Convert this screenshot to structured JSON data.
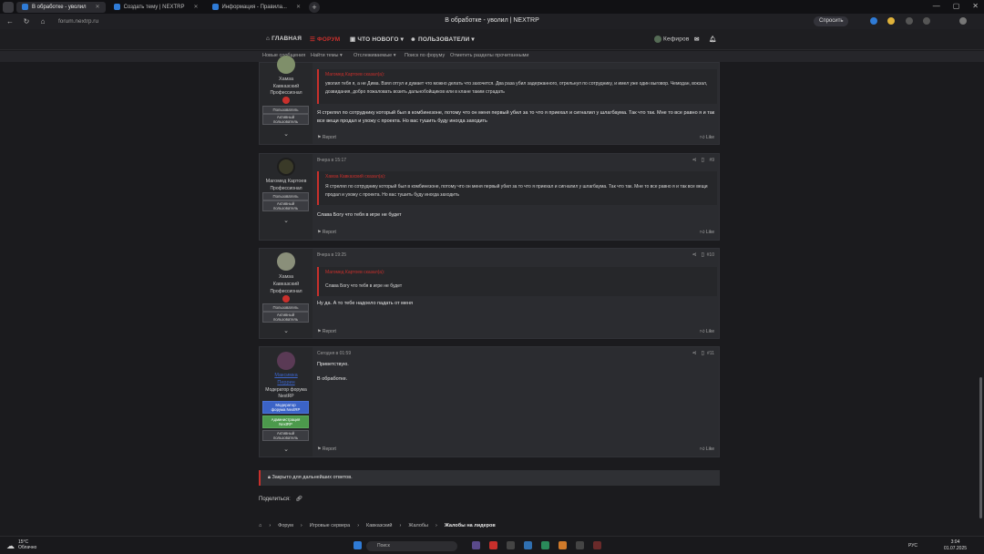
{
  "browser": {
    "tabs": [
      {
        "label": "В обработке - уволил"
      },
      {
        "label": "Создать тему | NEXTRP"
      },
      {
        "label": "Информация - Правила..."
      }
    ],
    "url": "forum.nextrp.ru",
    "page_title": "В обработке - уволил | NEXTRP",
    "ask_button": "Спросить"
  },
  "site": {
    "nav": [
      "ГЛАВНАЯ",
      "ФОРУМ",
      "ЧТО НОВОГО",
      "ПОЛЬЗОВАТЕЛИ"
    ],
    "user": "Кефиров",
    "subnav": [
      "Новые сообщения",
      "Найти темы",
      "Отслеживаемые",
      "Поиск по форуму",
      "Отметить разделы прочитанными"
    ]
  },
  "posts": [
    {
      "author": "Хамза Кавказский",
      "rank": "Профессионал",
      "badges": [
        "Пользователь",
        "Активный пользователь"
      ],
      "date": "",
      "number": "",
      "quote_author": "Магомед Картоев сказал(а):",
      "quote": "уволил тебя я, а не Дима. Взял отгул и думает что можно делать что захочется. Два раза убил задержанного, отрельнул по сотруднику, и имел уже один выговор. Чемодан, вокзал, дозвидания, добро пожаловать возить дальнобойщиков или в клане таким страдать",
      "text": "Я стрелял по сотруднику который был в комбинезоне, потому что он меня первый убил за то что я приехал и сигналил у шлагбаума. Так что так. Мне то все равно я и так все вещи продал и ухожу с проекта. Но вас тушить буду иногда заходить",
      "report": "Report",
      "like": "Like"
    },
    {
      "author": "Магомед Картоев",
      "rank": "Профессионал",
      "badges": [
        "Пользователь",
        "Активный пользователь"
      ],
      "date": "Вчера в 15:17",
      "number": "#9",
      "quote_author": "Хамза Кавказский сказал(а):",
      "quote": "Я стрелял по сотруднику который был в комбинезоне, потому что он меня первый убил за то что я приехал и сигналил у шлагбаума. Так что так. Мне то все равно я и так все вещи продал и ухожу с проекта. Но вас тушить буду иногда заходить",
      "text": "Слава Богу что тебя в игре не будет",
      "report": "Report",
      "like": "Like"
    },
    {
      "author": "Хамза Кавказский",
      "rank": "Профессионал",
      "badges": [
        "Пользователь",
        "Активный пользователь"
      ],
      "date": "Вчера в 19:25",
      "number": "#10",
      "quote_author": "Магомед Картоев сказал(а):",
      "quote": "Слава Богу что тебя в игре не будет",
      "text": "Ну да. А то тебе надоело падать от меня",
      "report": "Report",
      "like": "Like"
    },
    {
      "author": "Максимка Перрин",
      "rank": "Модератор форума NextRP",
      "badges": [
        "Модератор форума NextRP",
        "Администрация NextRP",
        "Активный пользователь"
      ],
      "date": "Сегодня в 01:59",
      "number": "#11",
      "text1": "Приветствую.",
      "text2": "В обработке.",
      "report": "Report",
      "like": "Like"
    }
  ],
  "closed_notice": "Закрыто для дальнейших ответов.",
  "share_label": "Поделиться:",
  "breadcrumbs": [
    "Форум",
    "Игровые сервера",
    "Кавказский",
    "Жалобы",
    "Жалобы на лидеров"
  ],
  "taskbar": {
    "temp": "15°C",
    "weather": "Облачно",
    "search": "Поиск",
    "lang": "РУС",
    "time": "3:04",
    "date": "01.07.2025"
  },
  "colors": {
    "accent": "#c9302c",
    "moderator_badge": "#3b63c7",
    "admin_badge": "#4c9a4c"
  }
}
